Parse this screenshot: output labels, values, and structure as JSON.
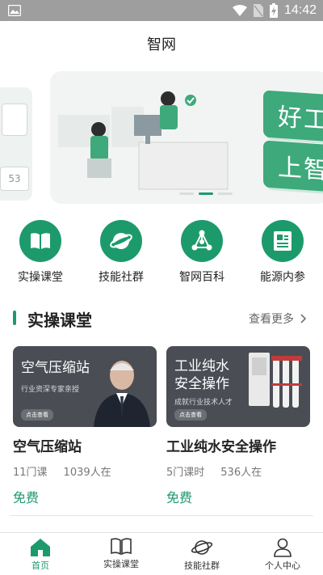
{
  "status_bar": {
    "time": "14:42"
  },
  "app": {
    "title": "智网"
  },
  "banner": {
    "slogan_line1": "好工作",
    "slogan_line2": "上智网",
    "left_card_number": "53"
  },
  "quick_nav": [
    {
      "label": "实操课堂",
      "icon": "book-icon"
    },
    {
      "label": "技能社群",
      "icon": "planet-icon"
    },
    {
      "label": "智网百科",
      "icon": "network-icon"
    },
    {
      "label": "能源内参",
      "icon": "newspaper-icon"
    }
  ],
  "section": {
    "title": "实操课堂",
    "more_label": "查看更多"
  },
  "courses": [
    {
      "thumb_title": "空气压缩站",
      "thumb_subtitle": "行业资深专家亲授",
      "thumb_button": "点击查看",
      "title": "空气压缩站",
      "lessons": "11门课",
      "learners": "1039人在",
      "price": "免费"
    },
    {
      "thumb_title_line1": "工业纯水",
      "thumb_title_line2": "安全操作",
      "thumb_subtitle": "成就行业技术人才",
      "thumb_button": "点击查看",
      "title": "工业纯水安全操作",
      "lessons": "5门课时",
      "learners": "536人在",
      "price": "免费"
    }
  ],
  "tab_bar": [
    {
      "label": "首页",
      "icon": "home-icon",
      "active": true
    },
    {
      "label": "实操课堂",
      "icon": "book-icon",
      "active": false
    },
    {
      "label": "技能社群",
      "icon": "planet-icon",
      "active": false
    },
    {
      "label": "个人中心",
      "icon": "person-icon",
      "active": false
    }
  ],
  "colors": {
    "accent": "#1d9a6c",
    "status_bar": "#9e9e9e",
    "slogan": "#3ea97b"
  }
}
